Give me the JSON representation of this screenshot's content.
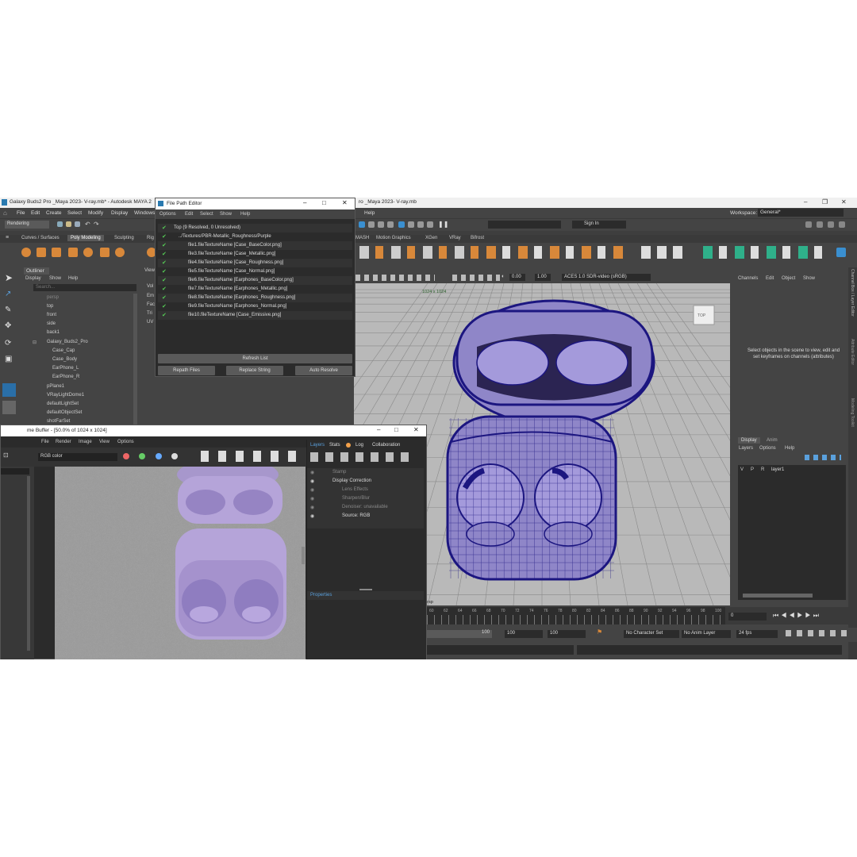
{
  "main_window": {
    "title": "Galaxy Buds2 Pro _Maya 2023- V-ray.mb* - Autodesk MAYA 2",
    "title_tail": "ro _Maya 2023- V-ray.mb"
  },
  "menubar": {
    "left": [
      "File",
      "Edit",
      "Create",
      "Select",
      "Modify",
      "Display",
      "Windows"
    ],
    "help": "Help",
    "workspace_label": "Workspace:",
    "workspace_value": "General*"
  },
  "toolbar": {
    "mode_dropdown": "Rendering",
    "sign_in": "Sign In"
  },
  "shelf_tabs": [
    "Curves / Surfaces",
    "Poly Modeling",
    "Sculpting",
    "Rig",
    "MASH",
    "Motion Graphics",
    "XGen",
    "VRay",
    "Bifrost"
  ],
  "outliner": {
    "title": "Outliner",
    "menu": [
      "Display",
      "Show",
      "Help"
    ],
    "search_placeholder": "Search...",
    "items": [
      "persp",
      "top",
      "front",
      "side",
      "back1",
      "Galaxy_Buds2_Pro",
      "Case_Cap",
      "Case_Body",
      "EarPhone_L",
      "EarPhone_R",
      "pPlane1",
      "VRayLightDome1",
      "defaultLightSet",
      "defaultObjectSet",
      "shotFarSet"
    ]
  },
  "attr_strip": {
    "items": [
      "View",
      "Vol",
      "Em",
      "Fac",
      "Tri",
      "UV"
    ]
  },
  "file_path_editor": {
    "title": "File Path Editor",
    "menu": [
      "Options",
      "Edit",
      "Select",
      "Show",
      "Help"
    ],
    "top_row": "Top (9 Resolved, 0 Unresolved)",
    "folder_row": "../Textures/PBR-Metallic_Roughness/Purple",
    "files": [
      "file1.fileTextureName [Case_BaseColor.png]",
      "file3.fileTextureName [Case_Metallic.png]",
      "file4.fileTextureName [Case_Roughness.png]",
      "file5.fileTextureName [Case_Normal.png]",
      "file6.fileTextureName [Earphones_BaseColor.png]",
      "file7.fileTextureName [Earphones_Metallic.png]",
      "file8.fileTextureName [Earphones_Roughness.png]",
      "file9.fileTextureName [Earphones_Normal.png]",
      "file10.fileTextureName [Case_Emissive.png]"
    ],
    "refresh": "Refresh List",
    "repath": "Repath Files",
    "replace": "Replace String",
    "auto_resolve": "Auto Resolve"
  },
  "viewport": {
    "resolution": "1024 x 1024",
    "exposure": "0.00",
    "gamma": "1.00",
    "color_space": "ACES 1.0 SDR-video (sRGB)",
    "cube_label": "TOP",
    "camera_label": "persp"
  },
  "channel_box": {
    "menu": [
      "Channels",
      "Edit",
      "Object",
      "Show"
    ],
    "hint": "Select objects in the scene to view, edit and set keyframes on channels (attributes)",
    "side_tabs": [
      "Channel Box / Layer Editor",
      "Attribute Editor",
      "Modeling Toolkit"
    ]
  },
  "layer_editor": {
    "tabs": [
      "Display",
      "Anim"
    ],
    "menu": [
      "Layers",
      "Options",
      "Help"
    ],
    "layer": {
      "v": "V",
      "p": "P",
      "r": "R",
      "name": "layer1"
    }
  },
  "timeline": {
    "ticks": [
      "60",
      "62",
      "64",
      "66",
      "68",
      "70",
      "72",
      "74",
      "76",
      "78",
      "80",
      "82",
      "84",
      "86",
      "88",
      "90",
      "92",
      "94",
      "96",
      "98",
      "100"
    ],
    "current_frame": "0"
  },
  "range": {
    "end_a": "100",
    "end_b": "100",
    "end_c": "100",
    "char_set": "No Character Set",
    "anim_layer": "No Anim Layer",
    "fps": "24 fps"
  },
  "frame_buffer": {
    "title": "me Buffer - [50.0% of 1024 x 1024]",
    "menu": [
      "File",
      "Render",
      "Image",
      "View",
      "Options"
    ],
    "channel": "RGB color",
    "tabs": [
      "Layers",
      "Stats",
      "Log",
      "Collaboration"
    ],
    "layers": [
      "Stamp",
      "Display Correction",
      "Lens Effects",
      "Sharpen/Blur",
      "Denoiser: unavailable",
      "Source: RGB"
    ],
    "properties": "Properties"
  },
  "colors": {
    "maya_bg": "#444444",
    "viewport_bg": "#b9b9b9",
    "mesh": "#1c1680",
    "case_fill": "#8f86c8",
    "render_bg": "#9a9a9a",
    "render_case": "#b5a4d9",
    "accent_blue": "#5aa0dc",
    "check_green": "#4fc04f"
  }
}
